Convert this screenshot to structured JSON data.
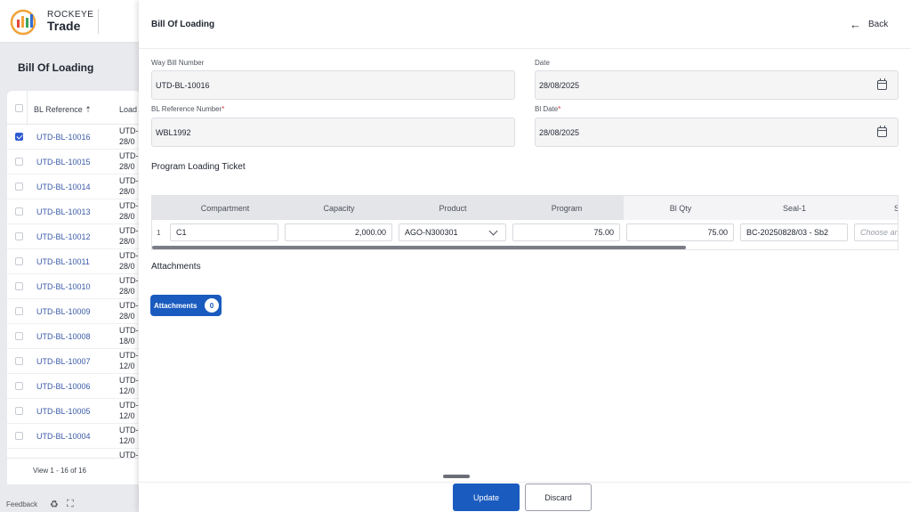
{
  "app": {
    "brand_top": "ROCKEYE",
    "brand_main": "Trade"
  },
  "list": {
    "title": "Bill Of Loading",
    "col_ref": "BL Reference",
    "col_load": "Load",
    "rows": [
      {
        "ref": "UTD-BL-10016",
        "load": "UTD-\n28/0",
        "checked": true
      },
      {
        "ref": "UTD-BL-10015",
        "load": "UTD-\n28/0"
      },
      {
        "ref": "UTD-BL-10014",
        "load": "UTD-\n28/0"
      },
      {
        "ref": "UTD-BL-10013",
        "load": "UTD-\n28/0"
      },
      {
        "ref": "UTD-BL-10012",
        "load": "UTD-\n28/0"
      },
      {
        "ref": "UTD-BL-10011",
        "load": "UTD-\n28/0"
      },
      {
        "ref": "UTD-BL-10010",
        "load": "UTD-\n28/0"
      },
      {
        "ref": "UTD-BL-10009",
        "load": "UTD-\n28/0"
      },
      {
        "ref": "UTD-BL-10008",
        "load": "UTD-\n18/0"
      },
      {
        "ref": "UTD-BL-10007",
        "load": "UTD-\n12/0"
      },
      {
        "ref": "UTD-BL-10006",
        "load": "UTD-\n12/0"
      },
      {
        "ref": "UTD-BL-10005",
        "load": "UTD-\n12/0"
      },
      {
        "ref": "UTD-BL-10004",
        "load": "UTD-\n12/0"
      },
      {
        "ref": "",
        "load": "UTD-"
      }
    ],
    "footer": "View 1 - 16 of 16"
  },
  "bottom_bar": {
    "feedback": "Feedback",
    "recycle_glyph": "♻",
    "expand_glyph": "⛶"
  },
  "drawer": {
    "title": "Bill Of Loading",
    "back_label": "Back",
    "back_glyph": "←",
    "fields": {
      "way_bill_label": "Way Bill Number",
      "way_bill_value": "UTD-BL-10016",
      "date_label": "Date",
      "date_value": "28/08/2025",
      "bl_ref_label": "BL Reference Number",
      "bl_ref_value": "WBL1992",
      "bl_date_label": "Bl Date",
      "bl_date_value": "28/08/2025",
      "required_mark": "*"
    },
    "program_section": "Program Loading Ticket",
    "grid": {
      "headers": [
        "Compartment",
        "Capacity",
        "Product",
        "Program",
        "Bl Qty",
        "Seal-1",
        "S"
      ],
      "row": {
        "num": "1",
        "compartment": "C1",
        "capacity": "2,000.00",
        "product": "AGO-N300301",
        "program": "75.00",
        "bl_qty": "75.00",
        "seal1": "BC-20250828/03 - Sb2",
        "seal2_placeholder": "Choose an"
      }
    },
    "attachments_section": "Attachments",
    "attachments_button": "Attachments",
    "attachments_count": "0",
    "update_label": "Update",
    "discard_label": "Discard"
  },
  "colors": {
    "primary": "#1a5bbf",
    "link": "#3a5aa8",
    "required": "#d43b3b"
  }
}
